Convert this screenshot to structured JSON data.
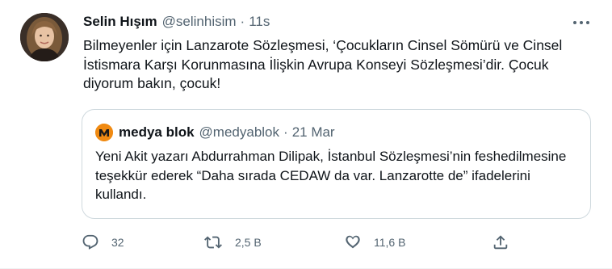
{
  "tweet": {
    "author_name": "Selin Hışım",
    "author_handle": "@selinhisim",
    "separator": "·",
    "time": "11s",
    "text": "Bilmeyenler için Lanzarote Sözleşmesi, ‘Çocukların Cinsel Sömürü ve Cinsel İstismara Karşı Korunmasına İlişkin Avrupa Konseyi Sözleşmesi’dir. Çocuk diyorum bakın, çocuk!"
  },
  "quoted_tweet": {
    "author_name": "medya blok",
    "author_handle": "@medyablok",
    "separator": "·",
    "date": "21 Mar",
    "text": "Yeni Akit yazarı Abdurrahman Dilipak, İstanbul Sözleşmesi’nin feshedilmesine teşekkür ederek “Daha sırada CEDAW da var. Lanzarotte de” ifadelerini kullandı."
  },
  "actions": {
    "reply": {
      "icon": "reply-icon",
      "count": "32"
    },
    "retweet": {
      "icon": "retweet-icon",
      "count": "2,5 B"
    },
    "like": {
      "icon": "heart-icon",
      "count": "11,6 B"
    },
    "share": {
      "icon": "share-icon"
    }
  },
  "colors": {
    "text_primary": "#0f1419",
    "text_secondary": "#536471",
    "border": "#cfd9de",
    "medya_blok_brand": "#f08a12"
  }
}
